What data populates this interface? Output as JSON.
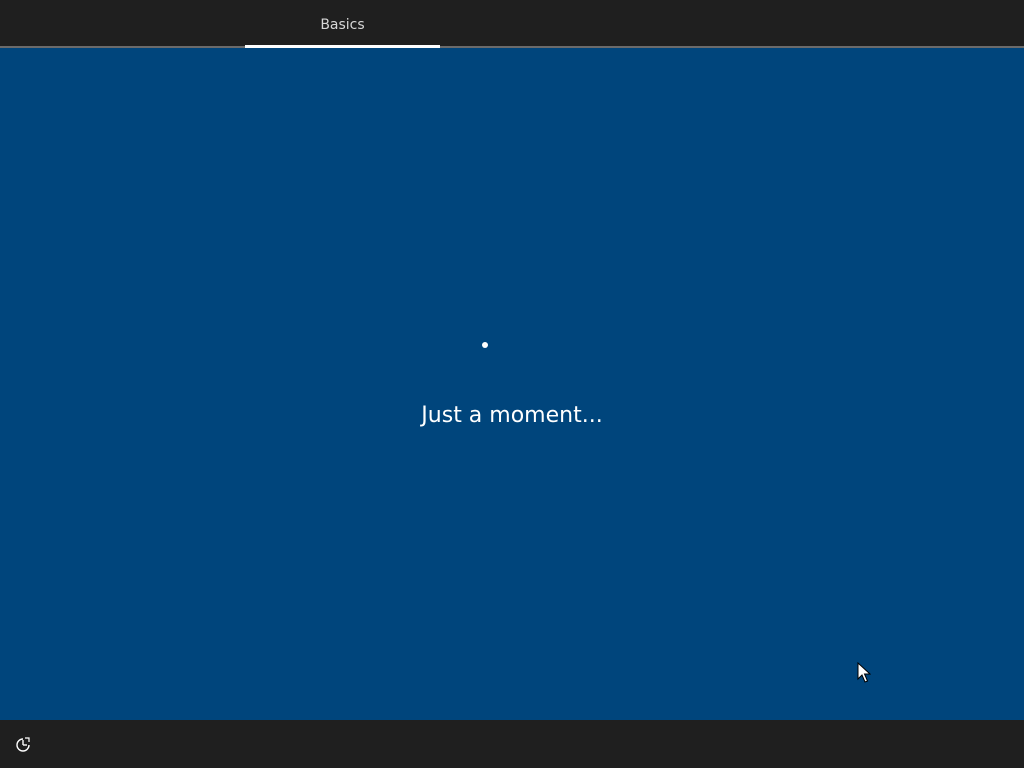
{
  "header": {
    "tabs": [
      {
        "label": "Basics",
        "active": true
      }
    ]
  },
  "main": {
    "status_text": "Just a moment..."
  },
  "footer": {
    "accessibility_icon": "ease-of-access-icon"
  },
  "colors": {
    "background": "#00457c",
    "bar": "#1f1f1f",
    "accent": "#ffffff"
  }
}
